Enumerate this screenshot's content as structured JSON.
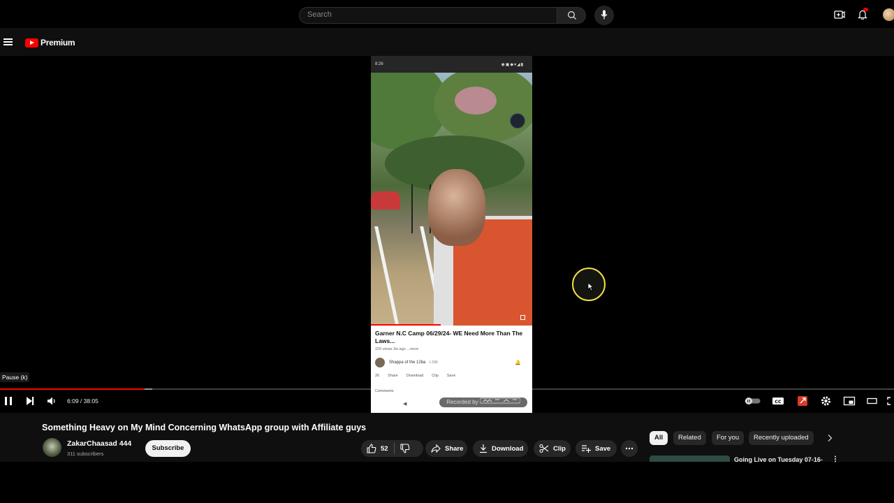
{
  "header": {
    "logo_text": "Premium",
    "search_placeholder": "Search"
  },
  "player": {
    "tooltip": "Pause (k)",
    "current_time": "6:09",
    "duration": "38:05",
    "time_display": "6:09 / 38:05",
    "progress_fraction": 0.162,
    "buffered_fraction": 0.17,
    "autoplay": "off",
    "recorded_badge": "Recorded by"
  },
  "embedded_phone": {
    "status_time": "8:26",
    "video_title": "Garner N.C Camp 06/29/24- WE Need More Than The Laws...",
    "meta": "229 views  2w ago  ...more",
    "channel": "Shappa of the 12ba",
    "subs": "1.58K",
    "actions": [
      "26",
      "Share",
      "Download",
      "Clip",
      "Save"
    ],
    "comments_label": "Comments"
  },
  "video": {
    "title": "Something Heavy on My Mind Concerning WhatsApp group with Affiliate guys",
    "channel_name": "ZakarChaasad 444",
    "subscribers": "311 subscribers",
    "subscribe_label": "Subscribe",
    "likes": "52",
    "share_label": "Share",
    "download_label": "Download",
    "clip_label": "Clip",
    "save_label": "Save"
  },
  "chips": [
    {
      "label": "All",
      "active": true
    },
    {
      "label": "Related",
      "active": false
    },
    {
      "label": "For you",
      "active": false
    },
    {
      "label": "Recently uploaded",
      "active": false
    }
  ],
  "recommendation": {
    "title": "Going Live on Tuesday 07-16-"
  },
  "colors": {
    "accent": "#ff0000",
    "background": "#0f0f0f",
    "cursor_ring": "#f0e040"
  }
}
